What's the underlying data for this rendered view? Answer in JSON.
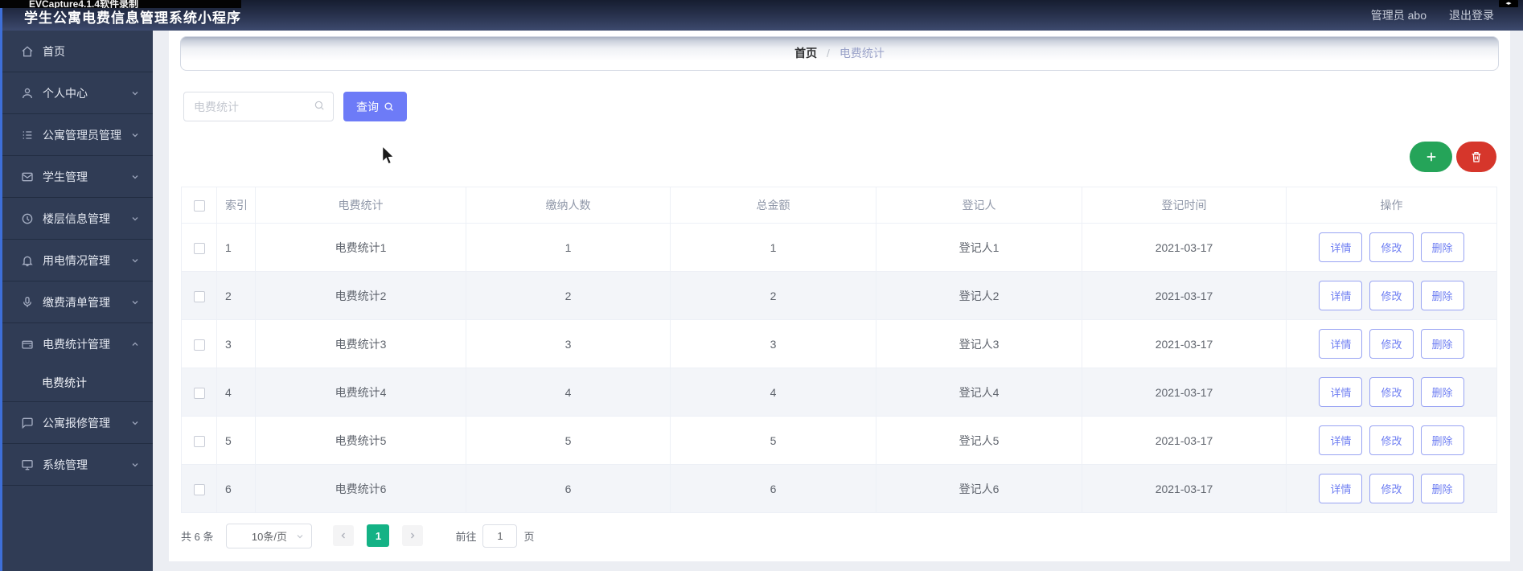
{
  "watermark": "EVCapture4.1.4软件录制",
  "titlebar": {
    "title": "学生公寓电费信息管理系统小程序",
    "user": "管理员 abo",
    "logout": "退出登录"
  },
  "sidebar": {
    "items": [
      {
        "id": "home",
        "icon": "home-icon",
        "label": "首页",
        "chevron": "none"
      },
      {
        "id": "personal-center",
        "icon": "user-icon",
        "label": "个人中心",
        "chevron": "down"
      },
      {
        "id": "apartment-admin",
        "icon": "list-icon",
        "label": "公寓管理员管理",
        "chevron": "down"
      },
      {
        "id": "student-mgmt",
        "icon": "mail-icon",
        "label": "学生管理",
        "chevron": "down"
      },
      {
        "id": "floor-info",
        "icon": "clock-icon",
        "label": "楼层信息管理",
        "chevron": "down"
      },
      {
        "id": "electricity-usage",
        "icon": "bell-icon",
        "label": "用电情况管理",
        "chevron": "down"
      },
      {
        "id": "payment-list",
        "icon": "mic-icon",
        "label": "缴费清单管理",
        "chevron": "down"
      },
      {
        "id": "fee-stats-mgmt",
        "icon": "wallet-icon",
        "label": "电费统计管理",
        "chevron": "up",
        "children": [
          {
            "id": "fee-stats",
            "label": "电费统计",
            "active": true
          }
        ]
      },
      {
        "id": "repair-mgmt",
        "icon": "chat-icon",
        "label": "公寓报修管理",
        "chevron": "down"
      },
      {
        "id": "system-mgmt",
        "icon": "monitor-icon",
        "label": "系统管理",
        "chevron": "down"
      }
    ]
  },
  "breadcrumb": {
    "home": "首页",
    "separator": "/",
    "current": "电费统计"
  },
  "toolbar": {
    "search_placeholder": "电费统计",
    "query_label": "查询"
  },
  "table": {
    "headers": [
      "索引",
      "电费统计",
      "缴纳人数",
      "总金额",
      "登记人",
      "登记时间",
      "操作"
    ],
    "row_actions": [
      "详情",
      "修改",
      "删除"
    ],
    "rows": [
      {
        "index": "1",
        "name": "电费统计1",
        "payers": "1",
        "total": "1",
        "registrar": "登记人1",
        "date": "2021-03-17"
      },
      {
        "index": "2",
        "name": "电费统计2",
        "payers": "2",
        "total": "2",
        "registrar": "登记人2",
        "date": "2021-03-17"
      },
      {
        "index": "3",
        "name": "电费统计3",
        "payers": "3",
        "total": "3",
        "registrar": "登记人3",
        "date": "2021-03-17"
      },
      {
        "index": "4",
        "name": "电费统计4",
        "payers": "4",
        "total": "4",
        "registrar": "登记人4",
        "date": "2021-03-17"
      },
      {
        "index": "5",
        "name": "电费统计5",
        "payers": "5",
        "total": "5",
        "registrar": "登记人5",
        "date": "2021-03-17"
      },
      {
        "index": "6",
        "name": "电费统计6",
        "payers": "6",
        "total": "6",
        "registrar": "登记人6",
        "date": "2021-03-17"
      }
    ]
  },
  "pagination": {
    "total": "共 6 条",
    "page_size": "10条/页",
    "current_page": "1",
    "goto_label": "前往",
    "goto_value": "1",
    "goto_suffix": "页"
  },
  "colors": {
    "primary": "#6d7bf7",
    "success_green": "#25a459",
    "danger_red": "#d6362b",
    "active_page_teal": "#14b285",
    "header_bg": "#2a3450",
    "sidebar_bg": "#303c55"
  }
}
